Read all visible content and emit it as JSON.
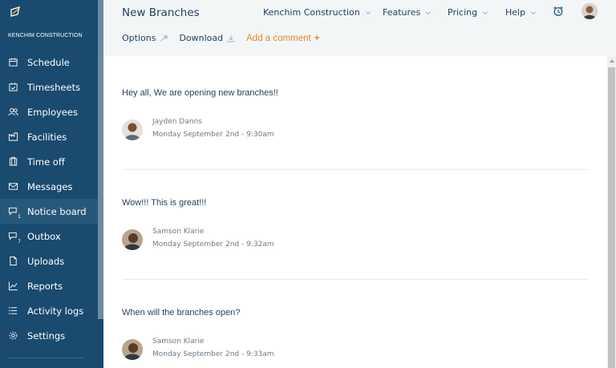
{
  "sidebar": {
    "company": "KENCHIM CONSTRUCTION",
    "items": [
      {
        "label": "Schedule",
        "icon": "calendar-icon"
      },
      {
        "label": "Timesheets",
        "icon": "timesheet-icon"
      },
      {
        "label": "Employees",
        "icon": "employees-icon"
      },
      {
        "label": "Facilities",
        "icon": "facilities-icon"
      },
      {
        "label": "Time off",
        "icon": "timeoff-icon"
      },
      {
        "label": "Messages",
        "icon": "mail-icon"
      },
      {
        "label": "Notice board",
        "icon": "notice-icon",
        "badge": "1",
        "active": true
      },
      {
        "label": "Outbox",
        "icon": "outbox-icon",
        "badge": "7"
      },
      {
        "label": "Uploads",
        "icon": "file-icon"
      },
      {
        "label": "Reports",
        "icon": "chart-icon"
      },
      {
        "label": "Activity logs",
        "icon": "list-icon"
      },
      {
        "label": "Settings",
        "icon": "gear-icon"
      }
    ]
  },
  "header": {
    "title": "New Branches",
    "nav": [
      {
        "label": "Kenchim Construction"
      },
      {
        "label": "Features"
      },
      {
        "label": "Pricing"
      },
      {
        "label": "Help"
      }
    ],
    "actions": {
      "options": "Options",
      "download": "Download",
      "comment": "Add a comment",
      "comment_plus": "+"
    }
  },
  "posts": [
    {
      "text": "Hey all, We are opening new branches!!",
      "author": "Jayden Danns",
      "date": "Monday September 2nd - 9:30am"
    },
    {
      "text": "Wow!!! This is great!!!",
      "author": "Samson Klarie",
      "date": "Monday September 2nd - 9:32am"
    },
    {
      "text": "When will the branches open?",
      "author": "Samson Klarie",
      "date": "Monday September 2nd - 9:33am"
    }
  ],
  "colors": {
    "sidebar": "#1a4a6e",
    "accent": "#e8862d",
    "text": "#1f3f5e"
  }
}
